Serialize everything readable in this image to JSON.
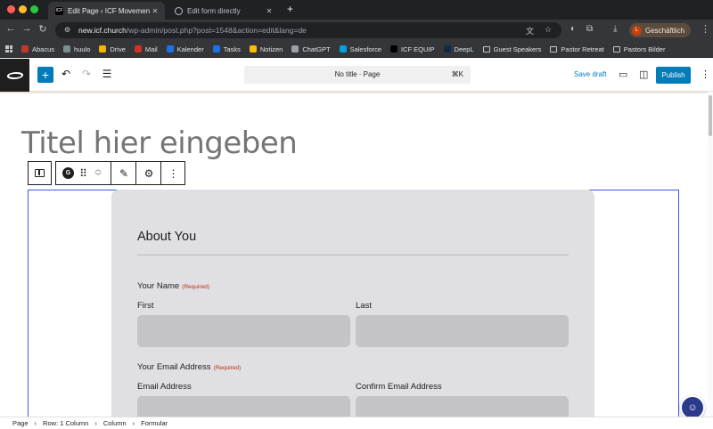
{
  "browser": {
    "tabs": [
      {
        "label": "Edit Page ‹ ICF Movement —",
        "active": true,
        "icon": "icf-logo-icon"
      },
      {
        "label": "Edit form directly",
        "active": false,
        "icon": "globe-icon"
      }
    ],
    "url_host": "new.icf.church",
    "url_path": "/wp-admin/post.php?post=1548&action=edit&lang=de",
    "profile_initial": "L",
    "profile_label": "Geschäftlich",
    "bookmarks": [
      {
        "label": "Abacus",
        "color": "#c0392b"
      },
      {
        "label": "huulo",
        "color": "#7f8c8d"
      },
      {
        "label": "Drive",
        "color": "#f4b400"
      },
      {
        "label": "Mail",
        "color": "#d93025"
      },
      {
        "label": "Kalender",
        "color": "#1a73e8"
      },
      {
        "label": "Tasks",
        "color": "#1a73e8"
      },
      {
        "label": "Notizen",
        "color": "#fbbc04"
      },
      {
        "label": "ChatGPT",
        "color": "#9aa0a6"
      },
      {
        "label": "Salesforce",
        "color": "#00a1e0"
      },
      {
        "label": "ICF EQUIP",
        "color": "#000000"
      },
      {
        "label": "DeepL",
        "color": "#0f2b46"
      },
      {
        "label": "Guest Speakers",
        "color": "folder"
      },
      {
        "label": "Pastor Retreat",
        "color": "folder"
      },
      {
        "label": "Pastors Bilder",
        "color": "folder"
      }
    ]
  },
  "editor": {
    "command_title": "No title · Page",
    "command_shortcut": "⌘K",
    "save_draft": "Save draft",
    "publish": "Publish",
    "post_title_placeholder": "Titel hier eingeben",
    "accent_color": "#007cba",
    "selection_color": "#3858e9"
  },
  "form": {
    "section_title": "About You",
    "required_text": "(Required)",
    "name_label": "Your Name",
    "first_label": "First",
    "last_label": "Last",
    "email_label": "Your Email Address",
    "email_sub_label": "Email Address",
    "confirm_email_label": "Confirm Email Address"
  },
  "breadcrumb": [
    "Page",
    "Row: 1 Column",
    "Column",
    "Formular"
  ]
}
